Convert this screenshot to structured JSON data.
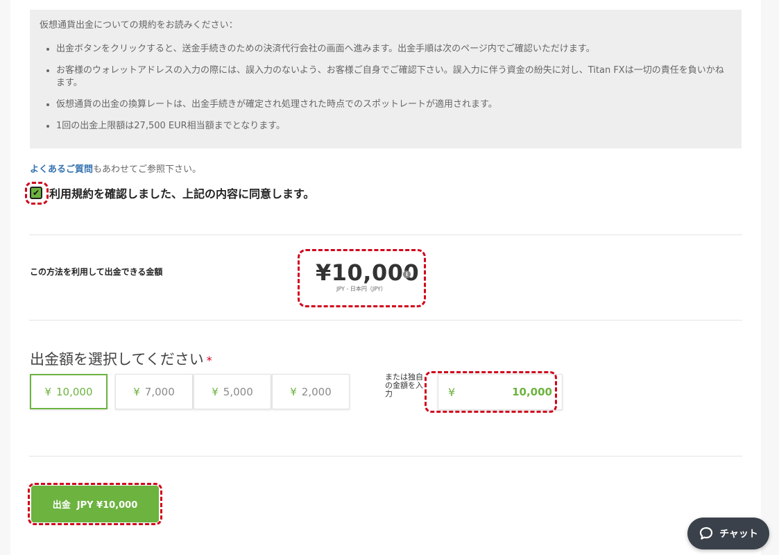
{
  "notice": {
    "heading": "仮想通貨出金についての規約をお読みください：",
    "items": [
      "出金ボタンをクリックすると、送金手続きのための決済代行会社の画面へ進みます。出金手順は次のページ内でご確認いただけます。",
      "お客様のウォレットアドレスの入力の際には、誤入力のないよう、お客様ご自身でご確認下さい。誤入力に伴う資金の紛失に対し、Titan FXは一切の責任を負いかねます。",
      "仮想通貨の出金の換算レートは、出金手続きが確定され処理された時点でのスポットレートが適用されます。",
      "1回の出金上限額は27,500 EUR相当額までとなります。"
    ]
  },
  "faq": {
    "link": "よくあるご質問",
    "suffix": "もあわせてご参照下さい。"
  },
  "agree": {
    "checked": true,
    "check_mark": "✔",
    "label": "利用規約を確認しました、上記の内容に同意します。"
  },
  "available": {
    "label": "この方法を利用して出金できる金額",
    "amount": "¥10,000",
    "currency_note": "JPY - 日本円（JPY）",
    "info_glyph": "i"
  },
  "select": {
    "title": "出金額を選択してください",
    "required_mark": "*",
    "currency_symbol": "¥",
    "options": [
      "10,000",
      "7,000",
      "5,000",
      "2,000"
    ],
    "selected_index": 0,
    "custom_label": "または独自の金額を入力",
    "custom_value": "10,000"
  },
  "withdraw_button": {
    "label": "出金  JPY ¥10,000"
  },
  "chat": {
    "label": "チャット",
    "icon": "chat-bubble-icon"
  },
  "colors": {
    "accent": "#6cb33f",
    "highlight": "#d0021b",
    "link": "#3572b0",
    "chat_bg": "#3a414a"
  }
}
